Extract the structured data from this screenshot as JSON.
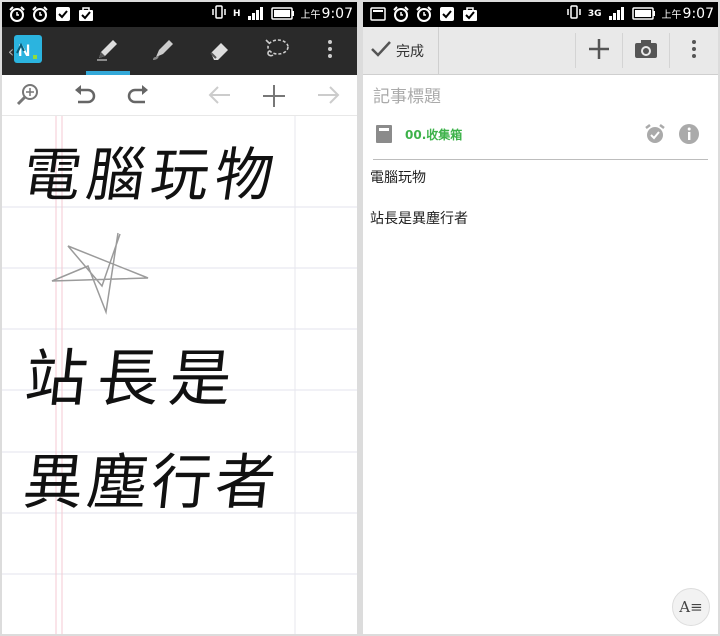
{
  "status_bar": {
    "left_panel": {
      "network": "H",
      "time_prefix": "上午",
      "time": "9:07"
    },
    "right_panel": {
      "network": "3G",
      "time_prefix": "上午",
      "time": "9:07"
    }
  },
  "left": {
    "toolbar": {
      "app_icon": "evernote-penultimate-icon",
      "tools": [
        "pen-icon",
        "brush-icon",
        "eraser-icon",
        "lasso-select-icon",
        "more-icon"
      ],
      "active_tool": "pen"
    },
    "sub_toolbar": [
      "zoom-icon",
      "undo-icon",
      "redo-icon",
      "page-prev-icon",
      "add-page-icon",
      "page-next-icon"
    ],
    "handwriting": [
      "電腦玩物",
      "站長是",
      "異塵行者"
    ]
  },
  "right": {
    "toolbar": {
      "done_label": "完成",
      "add_icon": "plus-icon",
      "camera_icon": "camera-icon",
      "menu_icon": "more-icon"
    },
    "title_placeholder": "記事標題",
    "notebook": "00.收集箱",
    "body_lines": [
      "電腦玩物",
      "站長是異塵行者"
    ],
    "font_button": "A≡"
  },
  "colors": {
    "accent_blue": "#33a8d8",
    "notebook_green": "#3db24a",
    "dark_toolbar": "#2a2a2a"
  }
}
